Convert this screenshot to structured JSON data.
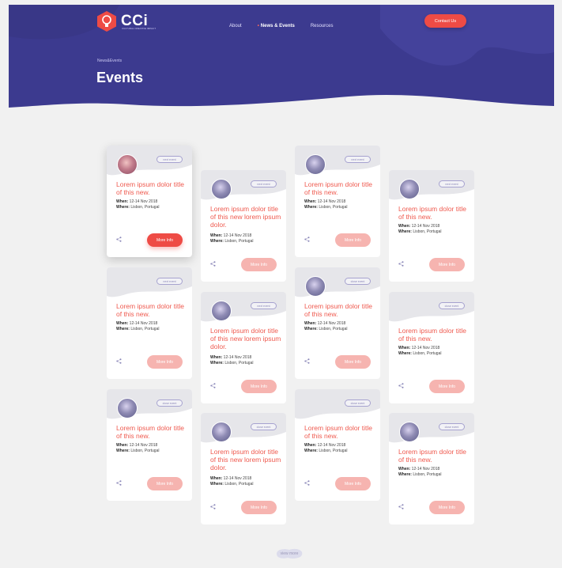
{
  "header": {
    "brand": "CCi",
    "tagline": "CULTURAL CREATIVE IMPACT",
    "nav": [
      {
        "label": "About",
        "active": false
      },
      {
        "label": "News & Events",
        "active": true
      },
      {
        "label": "Resources",
        "active": false
      }
    ],
    "contact_label": "Contact Us",
    "breadcrumb": "News&Events",
    "page_title": "Events"
  },
  "colors": {
    "hero": "#3c3a8f",
    "accent": "#ee4b45",
    "accent_light": "#f6b4b0",
    "title_red": "#ef5a4f"
  },
  "cards": [
    {
      "title": "Lorem ipsum dolor title of this new.",
      "when_label": "When:",
      "when": "12-14 Nov 2018",
      "where_label": "Where:",
      "where": "Lisbon, Portugal",
      "pill": "next event",
      "button": "More Info"
    },
    {
      "title": "Lorem ipsum dolor title of this new lorem ipsum dolor.",
      "when_label": "When:",
      "when": "12-14 Nov 2018",
      "where_label": "Where:",
      "where": "Lisbon, Portugal",
      "pill": "next event",
      "button": "More Info"
    },
    {
      "title": "Lorem ipsum dolor title of this new.",
      "when_label": "When:",
      "when": "12-14 Nov 2018",
      "where_label": "Where:",
      "where": "Lisbon, Portugal",
      "pill": "next event",
      "button": "More Info"
    },
    {
      "title": "Lorem ipsum dolor title of this new.",
      "when_label": "When:",
      "when": "12-14 Nov 2018",
      "where_label": "Where:",
      "where": "Lisbon, Portugal",
      "pill": "next event",
      "button": "More Info"
    },
    {
      "title": "Lorem ipsum dolor title of this new.",
      "when_label": "When:",
      "when": "12-14 Nov 2018",
      "where_label": "Where:",
      "where": "Lisbon, Portugal",
      "pill": "next event",
      "button": "More Info"
    },
    {
      "title": "Lorem ipsum dolor title of this new lorem ipsum dolor.",
      "when_label": "When:",
      "when": "12-14 Nov 2018",
      "where_label": "Where:",
      "where": "Lisbon, Portugal",
      "pill": "next event",
      "button": "More Info"
    },
    {
      "title": "Lorem ipsum dolor title of this new.",
      "when_label": "When:",
      "when": "12-14 Nov 2018",
      "where_label": "Where:",
      "where": "Lisbon, Portugal",
      "pill": "close event",
      "button": "More Info"
    },
    {
      "title": "Lorem ipsum dolor title of this new.",
      "when_label": "When:",
      "when": "12-14 Nov 2018",
      "where_label": "Where:",
      "where": "Lisbon, Portugal",
      "pill": "close event",
      "button": "More Info"
    },
    {
      "title": "Lorem ipsum dolor title of this new.",
      "when_label": "When:",
      "when": "12-14 Nov 2018",
      "where_label": "Where:",
      "where": "Lisbon, Portugal",
      "pill": "close event",
      "button": "More Info"
    },
    {
      "title": "Lorem ipsum dolor title of this new lorem ipsum dolor.",
      "when_label": "When:",
      "when": "12-14 Nov 2018",
      "where_label": "Where:",
      "where": "Lisbon, Portugal",
      "pill": "close event",
      "button": "More Info"
    },
    {
      "title": "Lorem ipsum dolor title of this new.",
      "when_label": "When:",
      "when": "12-14 Nov 2018",
      "where_label": "Where:",
      "where": "Lisbon, Portugal",
      "pill": "close event",
      "button": "More Info"
    },
    {
      "title": "Lorem ipsum dolor title of this new.",
      "when_label": "When:",
      "when": "12-14 Nov 2018",
      "where_label": "Where:",
      "where": "Lisbon, Portugal",
      "pill": "close event",
      "button": "More Info"
    }
  ],
  "view_more": "view more"
}
